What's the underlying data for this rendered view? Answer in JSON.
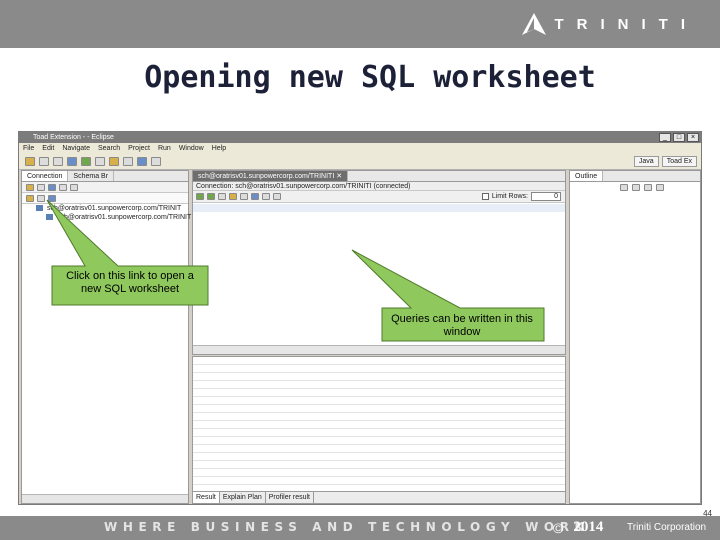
{
  "slide": {
    "title": "Opening new SQL worksheet",
    "logo_text": "TRINITI",
    "tagline": "WHERE BUSINESS AND TECHNOLOGY WORK",
    "copyright_symbol": "©",
    "year": "2014",
    "company": "Triniti Corporation",
    "page_number": "44"
  },
  "eclipse": {
    "window_title": "Toad Extension - - Eclipse",
    "menu": [
      "File",
      "Edit",
      "Navigate",
      "Search",
      "Project",
      "Run",
      "Window",
      "Help"
    ],
    "perspectives": [
      "Java",
      "Toad Ex"
    ],
    "left_tabs": [
      "Connection",
      "Schema Br"
    ],
    "connection_items": [
      "sch@oratrisv01.sunpowercorp.com/TRINIT",
      "sch@oratrisv01.sunpowercorp.com/TRINIT"
    ],
    "editor_tab": "sch@oratrisv01.sunpowercorp.com/TRINITI",
    "connection_label": "Connection: sch@oratrisv01.sunpowercorp.com/TRINITI (connected)",
    "limit_rows_label": "Limit Rows:",
    "limit_rows_value": "0",
    "outline_tab": "Outline",
    "result_tabs": [
      "Result",
      "Explain Plan",
      "Profiler result"
    ]
  },
  "callouts": {
    "link_hint": "Click on this link to open a new SQL worksheet",
    "editor_hint": "Queries can be written in this window"
  },
  "colors": {
    "band": "#8a8a8a",
    "callout_fill": "#8fc95e",
    "title": "#1c2138"
  }
}
